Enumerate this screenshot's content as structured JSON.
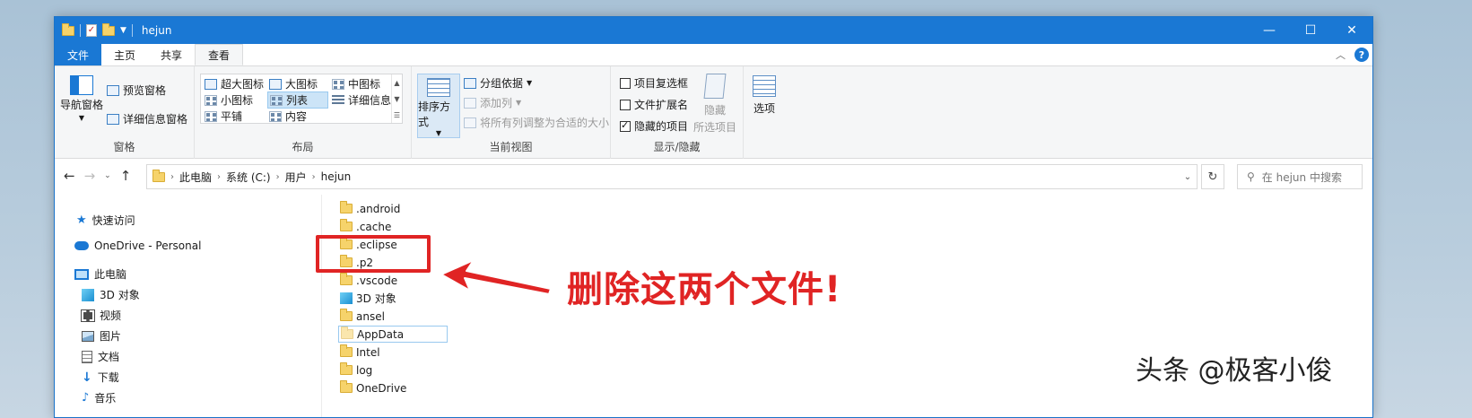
{
  "window": {
    "title": "hejun",
    "controls": {
      "minimize": "—",
      "maximize": "☐",
      "close": "✕"
    }
  },
  "ribbon_tabs": [
    {
      "label": "文件"
    },
    {
      "label": "主页"
    },
    {
      "label": "共享"
    },
    {
      "label": "查看"
    }
  ],
  "ribbon": {
    "panes": {
      "label": "窗格",
      "nav_pane": "导航窗格",
      "preview_pane": "预览窗格",
      "details_pane": "详细信息窗格"
    },
    "layout": {
      "label": "布局",
      "items": [
        "超大图标",
        "大图标",
        "中图标",
        "小图标",
        "列表",
        "详细信息",
        "平铺",
        "内容"
      ],
      "selected": "列表"
    },
    "current_view": {
      "label": "当前视图",
      "sort_by": "排序方式",
      "group_by": "分组依据",
      "add_columns": "添加列",
      "fit_columns": "将所有列调整为合适的大小"
    },
    "show_hide": {
      "label": "显示/隐藏",
      "item_checkboxes": {
        "label": "项目复选框",
        "checked": false
      },
      "file_extensions": {
        "label": "文件扩展名",
        "checked": false
      },
      "hidden_items": {
        "label": "隐藏的项目",
        "checked": true
      },
      "hide_selected_1": "隐藏",
      "hide_selected_2": "所选项目"
    },
    "options": {
      "label": "选项"
    }
  },
  "address": {
    "crumbs": [
      "此电脑",
      "系统 (C:)",
      "用户",
      "hejun"
    ],
    "search_placeholder": "在 hejun 中搜索"
  },
  "nav_pane": {
    "items": [
      {
        "label": "快速访问",
        "icon": "star-icon"
      },
      {
        "label": "OneDrive - Personal",
        "icon": "cloud-icon"
      },
      {
        "label": "此电脑",
        "icon": "computer-icon"
      },
      {
        "label": "3D 对象",
        "icon": "cube-icon"
      },
      {
        "label": "视频",
        "icon": "video-icon"
      },
      {
        "label": "图片",
        "icon": "pictures-icon"
      },
      {
        "label": "文档",
        "icon": "documents-icon"
      },
      {
        "label": "下载",
        "icon": "download-icon"
      },
      {
        "label": "音乐",
        "icon": "music-icon"
      }
    ]
  },
  "files": [
    {
      "name": ".android",
      "icon": "folder"
    },
    {
      "name": ".cache",
      "icon": "folder"
    },
    {
      "name": ".eclipse",
      "icon": "folder"
    },
    {
      "name": ".p2",
      "icon": "folder"
    },
    {
      "name": ".vscode",
      "icon": "folder"
    },
    {
      "name": "3D 对象",
      "icon": "cube"
    },
    {
      "name": "ansel",
      "icon": "folder"
    },
    {
      "name": "AppData",
      "icon": "folder-faded"
    },
    {
      "name": "Intel",
      "icon": "folder"
    },
    {
      "name": "log",
      "icon": "folder"
    },
    {
      "name": "OneDrive",
      "icon": "folder"
    }
  ],
  "annotation": {
    "text": "删除这两个文件!",
    "color": "#e02424"
  },
  "watermark": "头条 @极客小俊",
  "colors": {
    "accent": "#1a78d4",
    "annotation": "#e02424"
  }
}
